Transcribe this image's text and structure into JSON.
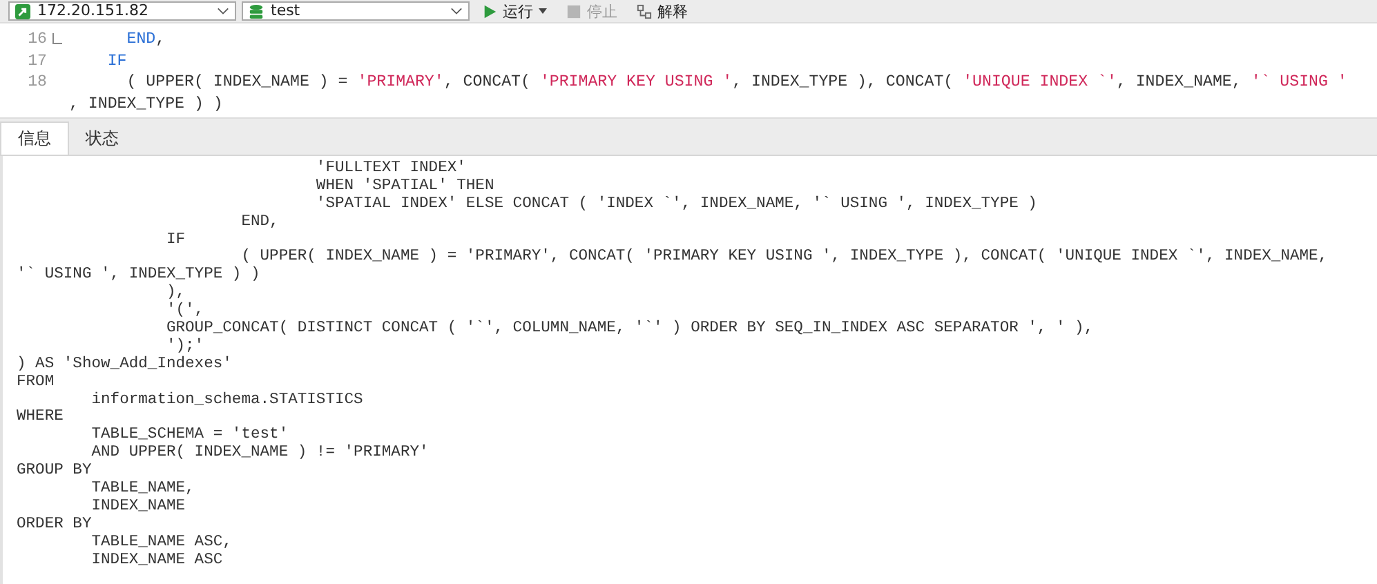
{
  "toolbar": {
    "connection": "172.20.151.82",
    "database": "test",
    "buttons": [
      {
        "kind": "run",
        "label": "运行",
        "disabled": false
      },
      {
        "kind": "stop",
        "label": "停止",
        "disabled": true
      },
      {
        "kind": "explain",
        "label": "解释",
        "disabled": false
      }
    ]
  },
  "editor": {
    "lines": [
      {
        "number": "16",
        "tokens": [
          {
            "kind": "keyword",
            "text": "      END"
          },
          {
            "kind": "plain",
            "text": ","
          }
        ]
      },
      {
        "number": "17",
        "tokens": [
          {
            "kind": "keyword",
            "text": "    IF"
          }
        ]
      },
      {
        "number": "18",
        "tokens": [
          {
            "kind": "plain",
            "text": "      ( UPPER( INDEX_NAME ) = "
          },
          {
            "kind": "string",
            "text": "'PRIMARY'"
          },
          {
            "kind": "plain",
            "text": ", CONCAT( "
          },
          {
            "kind": "string",
            "text": "'PRIMARY KEY USING '"
          },
          {
            "kind": "plain",
            "text": ", INDEX_TYPE ), CONCAT( "
          },
          {
            "kind": "string",
            "text": "'UNIQUE INDEX `'"
          },
          {
            "kind": "plain",
            "text": ", INDEX_NAME, "
          },
          {
            "kind": "string",
            "text": "'` USING '"
          }
        ]
      },
      {
        "tokens": [
          {
            "kind": "plain",
            "text": ", INDEX_TYPE ) )"
          }
        ]
      }
    ]
  },
  "tabs": [
    {
      "label": "信息",
      "selected": true
    },
    {
      "label": "状态",
      "selected": false
    }
  ],
  "output": {
    "lines": [
      "                                'FULLTEXT INDEX'",
      "                                WHEN 'SPATIAL' THEN",
      "                                'SPATIAL INDEX' ELSE CONCAT ( 'INDEX `', INDEX_NAME, '` USING ', INDEX_TYPE )",
      "                        END,",
      "                IF",
      "                        ( UPPER( INDEX_NAME ) = 'PRIMARY', CONCAT( 'PRIMARY KEY USING ', INDEX_TYPE ), CONCAT( 'UNIQUE INDEX `', INDEX_NAME,",
      "'` USING ', INDEX_TYPE ) )",
      "                ),",
      "                '(',",
      "                GROUP_CONCAT( DISTINCT CONCAT ( '`', COLUMN_NAME, '`' ) ORDER BY SEQ_IN_INDEX ASC SEPARATOR ', ' ),",
      "                ');'",
      ") AS 'Show_Add_Indexes'",
      "FROM",
      "        information_schema.STATISTICS",
      "WHERE",
      "        TABLE_SCHEMA = 'test'",
      "        AND UPPER( INDEX_NAME ) != 'PRIMARY'",
      "GROUP BY",
      "        TABLE_NAME,",
      "        INDEX_NAME",
      "ORDER BY",
      "        TABLE_NAME ASC,",
      "        INDEX_NAME ASC"
    ]
  }
}
